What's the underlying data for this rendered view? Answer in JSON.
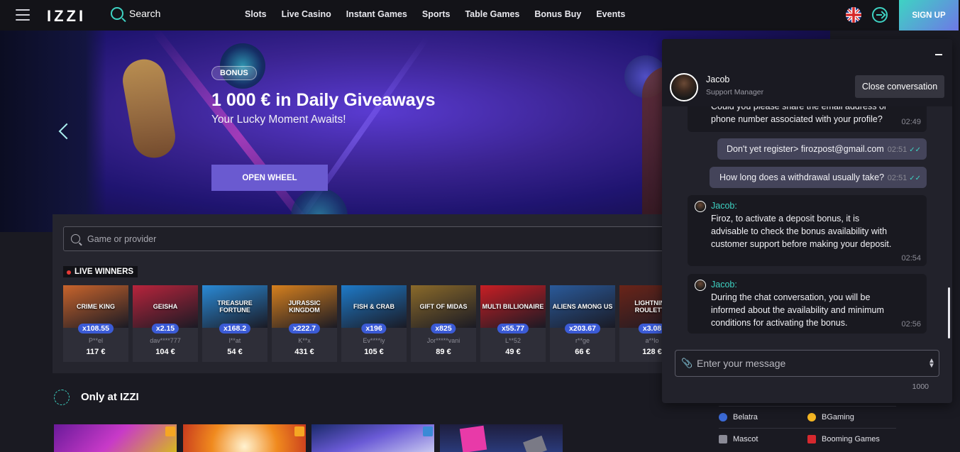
{
  "header": {
    "logo": "IZZI",
    "search_label": "Search",
    "nav": [
      "Slots",
      "Live Casino",
      "Instant Games",
      "Sports",
      "Table Games",
      "Bonus Buy",
      "Events"
    ],
    "signup": "SIGN UP"
  },
  "hero": {
    "badge": "BONUS",
    "title": "1 000 € in Daily Giveaways",
    "subtitle": "Your Lucky Moment Awaits!",
    "button": "OPEN WHEEL"
  },
  "games": {
    "search_placeholder": "Game or provider",
    "live_winners_label": "LIVE WINNERS",
    "winners": [
      {
        "game": "CRIME KING",
        "multiplier": "x108.55",
        "name": "P**el",
        "amount": "117 €",
        "color": "#c8642c"
      },
      {
        "game": "GEISHA",
        "multiplier": "x2.15",
        "name": "dav****777",
        "amount": "104 €",
        "color": "#b8243c"
      },
      {
        "game": "TREASURE FORTUNE",
        "multiplier": "x168.2",
        "name": "l**at",
        "amount": "54 €",
        "color": "#2a8ad6"
      },
      {
        "game": "JURASSIC KINGDOM",
        "multiplier": "x222.7",
        "name": "K**x",
        "amount": "431 €",
        "color": "#d6801e"
      },
      {
        "game": "FISH & CRAB",
        "multiplier": "x196",
        "name": "Ev****iy",
        "amount": "105 €",
        "color": "#1e7ac8"
      },
      {
        "game": "GIFT OF MIDAS",
        "multiplier": "x825",
        "name": "Jor*****vani",
        "amount": "89 €",
        "color": "#8a6a2a"
      },
      {
        "game": "MULTI BILLIONAIRE",
        "multiplier": "x55.77",
        "name": "L**52",
        "amount": "49 €",
        "color": "#c81e24"
      },
      {
        "game": "ALIENS AMONG US",
        "multiplier": "x203.67",
        "name": "r**ge",
        "amount": "66 €",
        "color": "#2a5a9a"
      },
      {
        "game": "LIGHTNING ROULETTE",
        "multiplier": "x3.08",
        "name": "a**lo",
        "amount": "128 €",
        "color": "#6a2418"
      }
    ]
  },
  "only": {
    "title": "Only at IZZI"
  },
  "providers": [
    [
      "Belatra",
      "BGaming"
    ],
    [
      "Mascot",
      "Booming Games"
    ]
  ],
  "chat": {
    "agent_name": "Jacob",
    "agent_role": "Support Manager",
    "close_button": "Close conversation",
    "messages": [
      {
        "text": "Could you please share the email address or phone number associated with your profile?",
        "time": "02:49"
      },
      {
        "text": "Don't yet register> firozpost@gmail.com",
        "time": "02:51"
      },
      {
        "text": "How long does a withdrawal usually take?",
        "time": "02:51"
      },
      {
        "sender": "Jacob",
        "text": "Firoz, to activate a deposit bonus, it is advisable to check the bonus availability with customer support before making your deposit.",
        "time": "02:54"
      },
      {
        "sender": "Jacob",
        "text": "During the chat conversation, you will be informed about the availability and minimum conditions for activating the bonus.",
        "time": "02:56"
      }
    ],
    "input_placeholder": "Enter your message",
    "char_limit": "1000"
  },
  "colors": {
    "accent": "#3ed3c3",
    "signup_gradient_end": "#6e78e6",
    "multiplier_badge": "#3b5bd6"
  }
}
